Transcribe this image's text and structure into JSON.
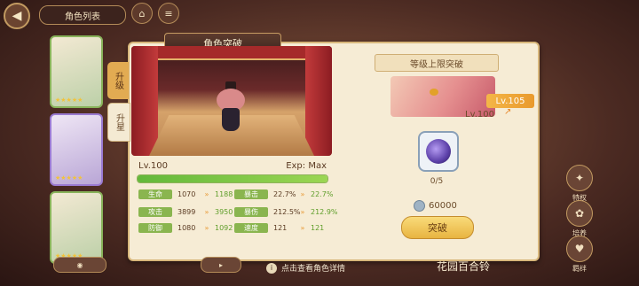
{
  "header": {
    "list_tab": "角色列表"
  },
  "panel": {
    "title": "角色突破",
    "side_tabs": [
      "升级",
      "升星"
    ]
  },
  "character": {
    "level": "Lv.100",
    "exp": "Exp: Max",
    "exp_fraction": 1.0,
    "name": "花园百合铃"
  },
  "stats": [
    {
      "label": "生命",
      "from": "1070",
      "to": "1188"
    },
    {
      "label": "攻击",
      "from": "3899",
      "to": "3950"
    },
    {
      "label": "防御",
      "from": "1080",
      "to": "1092"
    },
    {
      "label": "暴击",
      "from": "22.7%",
      "to": "22.7%"
    },
    {
      "label": "暴伤",
      "from": "212.5%",
      "to": "212.9%"
    },
    {
      "label": "速度",
      "from": "121",
      "to": "121"
    }
  ],
  "breakthrough": {
    "title": "等级上限突破",
    "new_level": "Lv.105",
    "old_level": "Lv.100",
    "item_count": "0/5",
    "cost": "60000",
    "button": "突破"
  },
  "right_menu": [
    "特权",
    "培养",
    "羁绊"
  ],
  "hint": "点击查看角色详情",
  "colors": {
    "accent": "#e8b441",
    "stat_tag": "#8ab54f",
    "panel_bg": "#f6ecd5"
  }
}
